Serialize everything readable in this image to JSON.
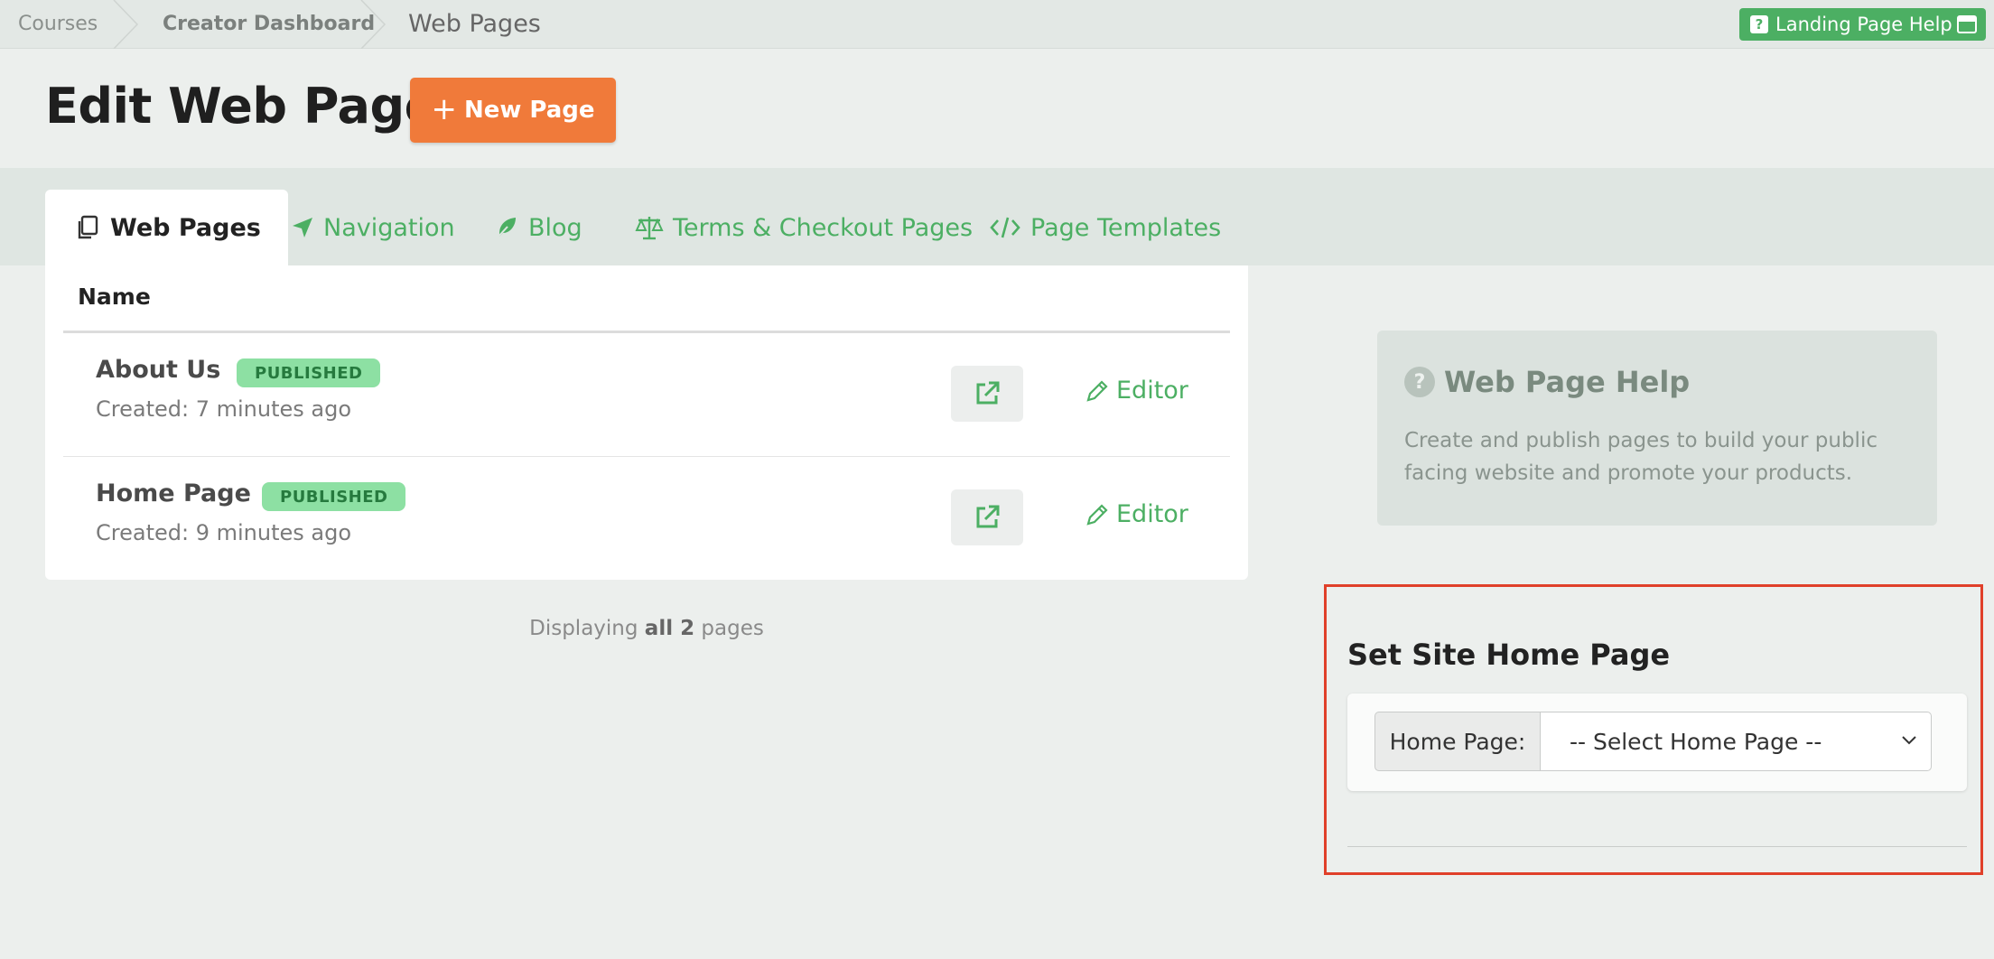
{
  "breadcrumb": {
    "items": [
      "Courses",
      "Creator Dashboard",
      "Web Pages"
    ]
  },
  "help_button": {
    "label": "Landing Page Help",
    "icon": "question-square-icon",
    "panel_icon": "panel-toggle-icon"
  },
  "header": {
    "title": "Edit Web Pages",
    "new_page_label": "New Page"
  },
  "tabs": [
    {
      "label": "Web Pages",
      "icon": "copy-pages-icon",
      "active": true
    },
    {
      "label": "Navigation",
      "icon": "location-arrow-icon",
      "active": false
    },
    {
      "label": "Blog",
      "icon": "feather-icon",
      "active": false
    },
    {
      "label": "Terms & Checkout Pages",
      "icon": "scale-icon",
      "active": false
    },
    {
      "label": "Page Templates",
      "icon": "code-icon",
      "active": false
    }
  ],
  "table": {
    "column_name": "Name",
    "rows": [
      {
        "name": "About Us",
        "status": "PUBLISHED",
        "created": "Created: 7 minutes ago",
        "editor_label": "Editor"
      },
      {
        "name": "Home Page",
        "status": "PUBLISHED",
        "created": "Created: 9 minutes ago",
        "editor_label": "Editor"
      }
    ]
  },
  "footer": {
    "prefix": "Displaying",
    "count_text": "all 2",
    "suffix": "pages"
  },
  "help_box": {
    "title": "Web Page Help",
    "text": "Create and publish pages to build your public facing website and promote your products."
  },
  "home_page": {
    "title": "Set Site Home Page",
    "addon_label": "Home Page:",
    "selected": "-- Select Home Page --"
  },
  "colors": {
    "accent_green": "#4caf63",
    "new_button": "#f07a3a",
    "highlight": "#e0402a",
    "badge_bg": "#8de0a3"
  }
}
